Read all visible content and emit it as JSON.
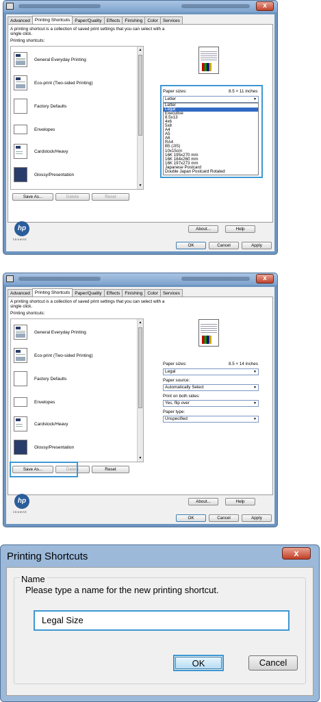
{
  "window1": {
    "tabs": [
      "Advanced",
      "Printing Shortcuts",
      "Paper/Quality",
      "Effects",
      "Finishing",
      "Color",
      "Services"
    ],
    "active_tab": "Printing Shortcuts",
    "description": "A printing shortcut is a collection of saved print settings that you can select with a single click.",
    "shortcuts_label": "Printing shortcuts:",
    "shortcuts": [
      "General Everyday Printing",
      "Eco-print (Two-sided Printing)",
      "Factory Defaults",
      "Envelopes",
      "Cardstock/Heavy",
      "Glossy/Presentation"
    ],
    "buttons": {
      "save_as": "Save As...",
      "delete": "Delete",
      "reset": "Reset"
    },
    "paper_sizes_label": "Paper sizes:",
    "paper_size_dim": "8.5 × 11 inches",
    "paper_size_value": "Letter",
    "paper_options": [
      "Letter",
      "Legal",
      "Executive",
      "8.5x13",
      "4x6",
      "5x8",
      "A4",
      "A5",
      "A6",
      "RA4",
      "B5 (JIS)",
      "10x15cm",
      "16K 195x270 mm",
      "16K 184x260 mm",
      "16K 197x273 mm",
      "Japanese Postcard",
      "Double Japan Postcard Rotated"
    ],
    "highlighted_option": "Legal",
    "about": "About...",
    "help": "Help",
    "ok": "OK",
    "cancel": "Cancel",
    "apply": "Apply",
    "logo_text": "hp",
    "invent": "invent"
  },
  "window2": {
    "tabs": [
      "Advanced",
      "Printing Shortcuts",
      "Paper/Quality",
      "Effects",
      "Finishing",
      "Color",
      "Services"
    ],
    "description": "A printing shortcut is a collection of saved print settings that you can select with a single click.",
    "shortcuts_label": "Printing shortcuts:",
    "shortcuts": [
      "General Everyday Printing",
      "Eco-print (Two-sided Printing)",
      "Factory Defaults",
      "Envelopes",
      "Cardstock/Heavy",
      "Glossy/Presentation"
    ],
    "buttons": {
      "save_as": "Save As...",
      "delete": "Delete",
      "reset": "Reset"
    },
    "paper_sizes_label": "Paper sizes:",
    "paper_size_dim": "8.5 × 14 inches",
    "paper_size_value": "Legal",
    "paper_source_label": "Paper source:",
    "paper_source_value": "Automatically Select",
    "both_sides_label": "Print on both sides:",
    "both_sides_value": "Yes, flip over",
    "paper_type_label": "Paper type:",
    "paper_type_value": "Unspecified",
    "about": "About...",
    "help": "Help",
    "ok": "OK",
    "cancel": "Cancel",
    "apply": "Apply",
    "logo_text": "hp",
    "invent": "invent"
  },
  "dialog": {
    "title": "Printing Shortcuts",
    "close": "x",
    "group_label": "Name",
    "prompt": "Please type a name for the new printing shortcut.",
    "name_value": "Legal Size",
    "ok": "OK",
    "cancel": "Cancel"
  },
  "colors": {
    "highlight": "#3b97d3",
    "selection": "#316ac5"
  }
}
